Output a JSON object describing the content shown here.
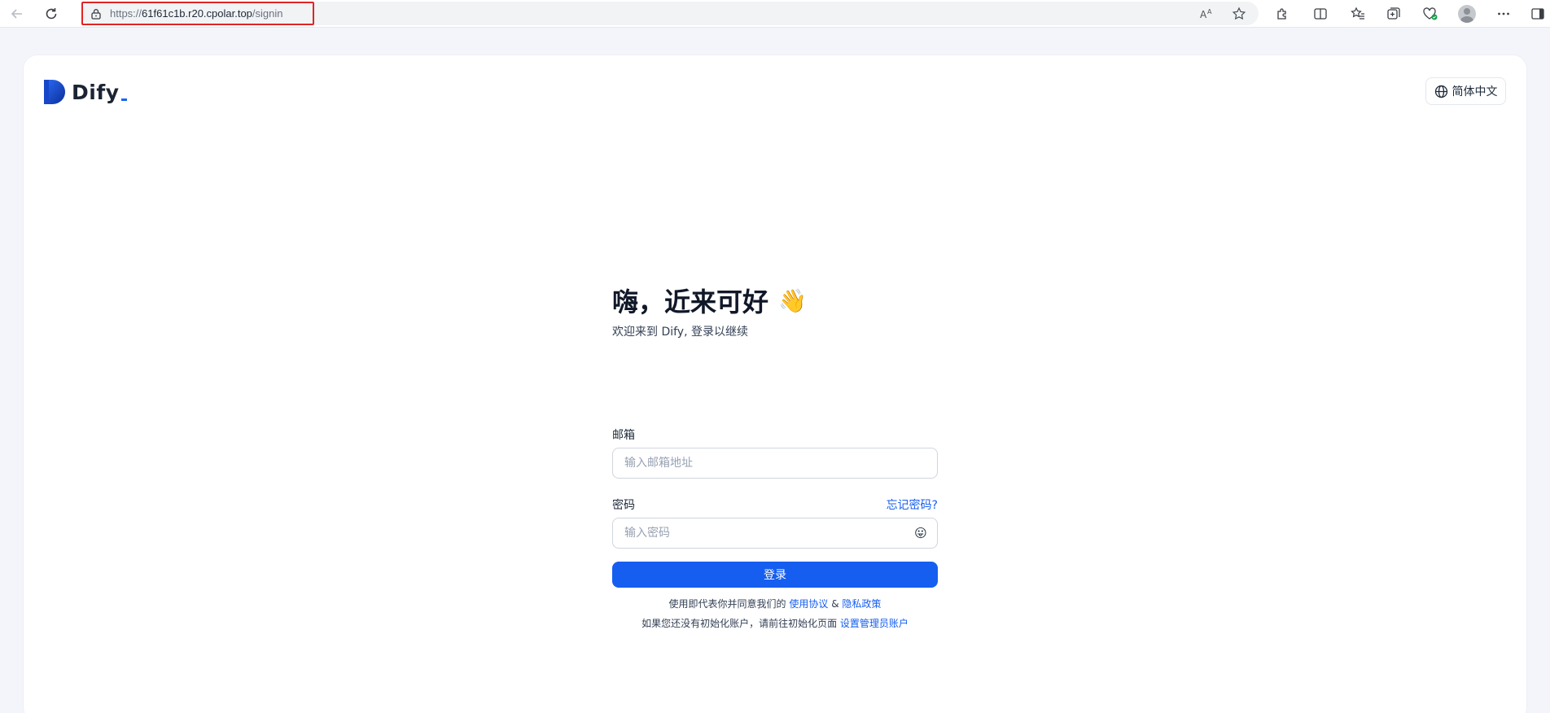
{
  "browser": {
    "url_scheme": "https://",
    "url_host": "61f61c1b.r20.cpolar.top",
    "url_path": "/signin"
  },
  "header": {
    "logo_text": "Dify",
    "language_label": "简体中文"
  },
  "login": {
    "title": "嗨，近来可好",
    "wave_emoji": "👋",
    "subtitle": "欢迎来到 Dify, 登录以继续",
    "email_label": "邮箱",
    "email_placeholder": "输入邮箱地址",
    "email_value": "",
    "password_label": "密码",
    "forgot_password": "忘记密码?",
    "password_placeholder": "输入密码",
    "password_value": "",
    "password_toggle_emoji": "😛",
    "submit_label": "登录",
    "terms_prefix": "使用即代表你并同意我们的",
    "terms_link": "使用协议",
    "terms_and": "&",
    "privacy_link": "隐私政策",
    "admin_prefix": "如果您还没有初始化账户，请前往初始化页面",
    "admin_link": "设置管理员账户"
  },
  "colors": {
    "primary": "#155eef",
    "url_highlight": "#e02424"
  }
}
